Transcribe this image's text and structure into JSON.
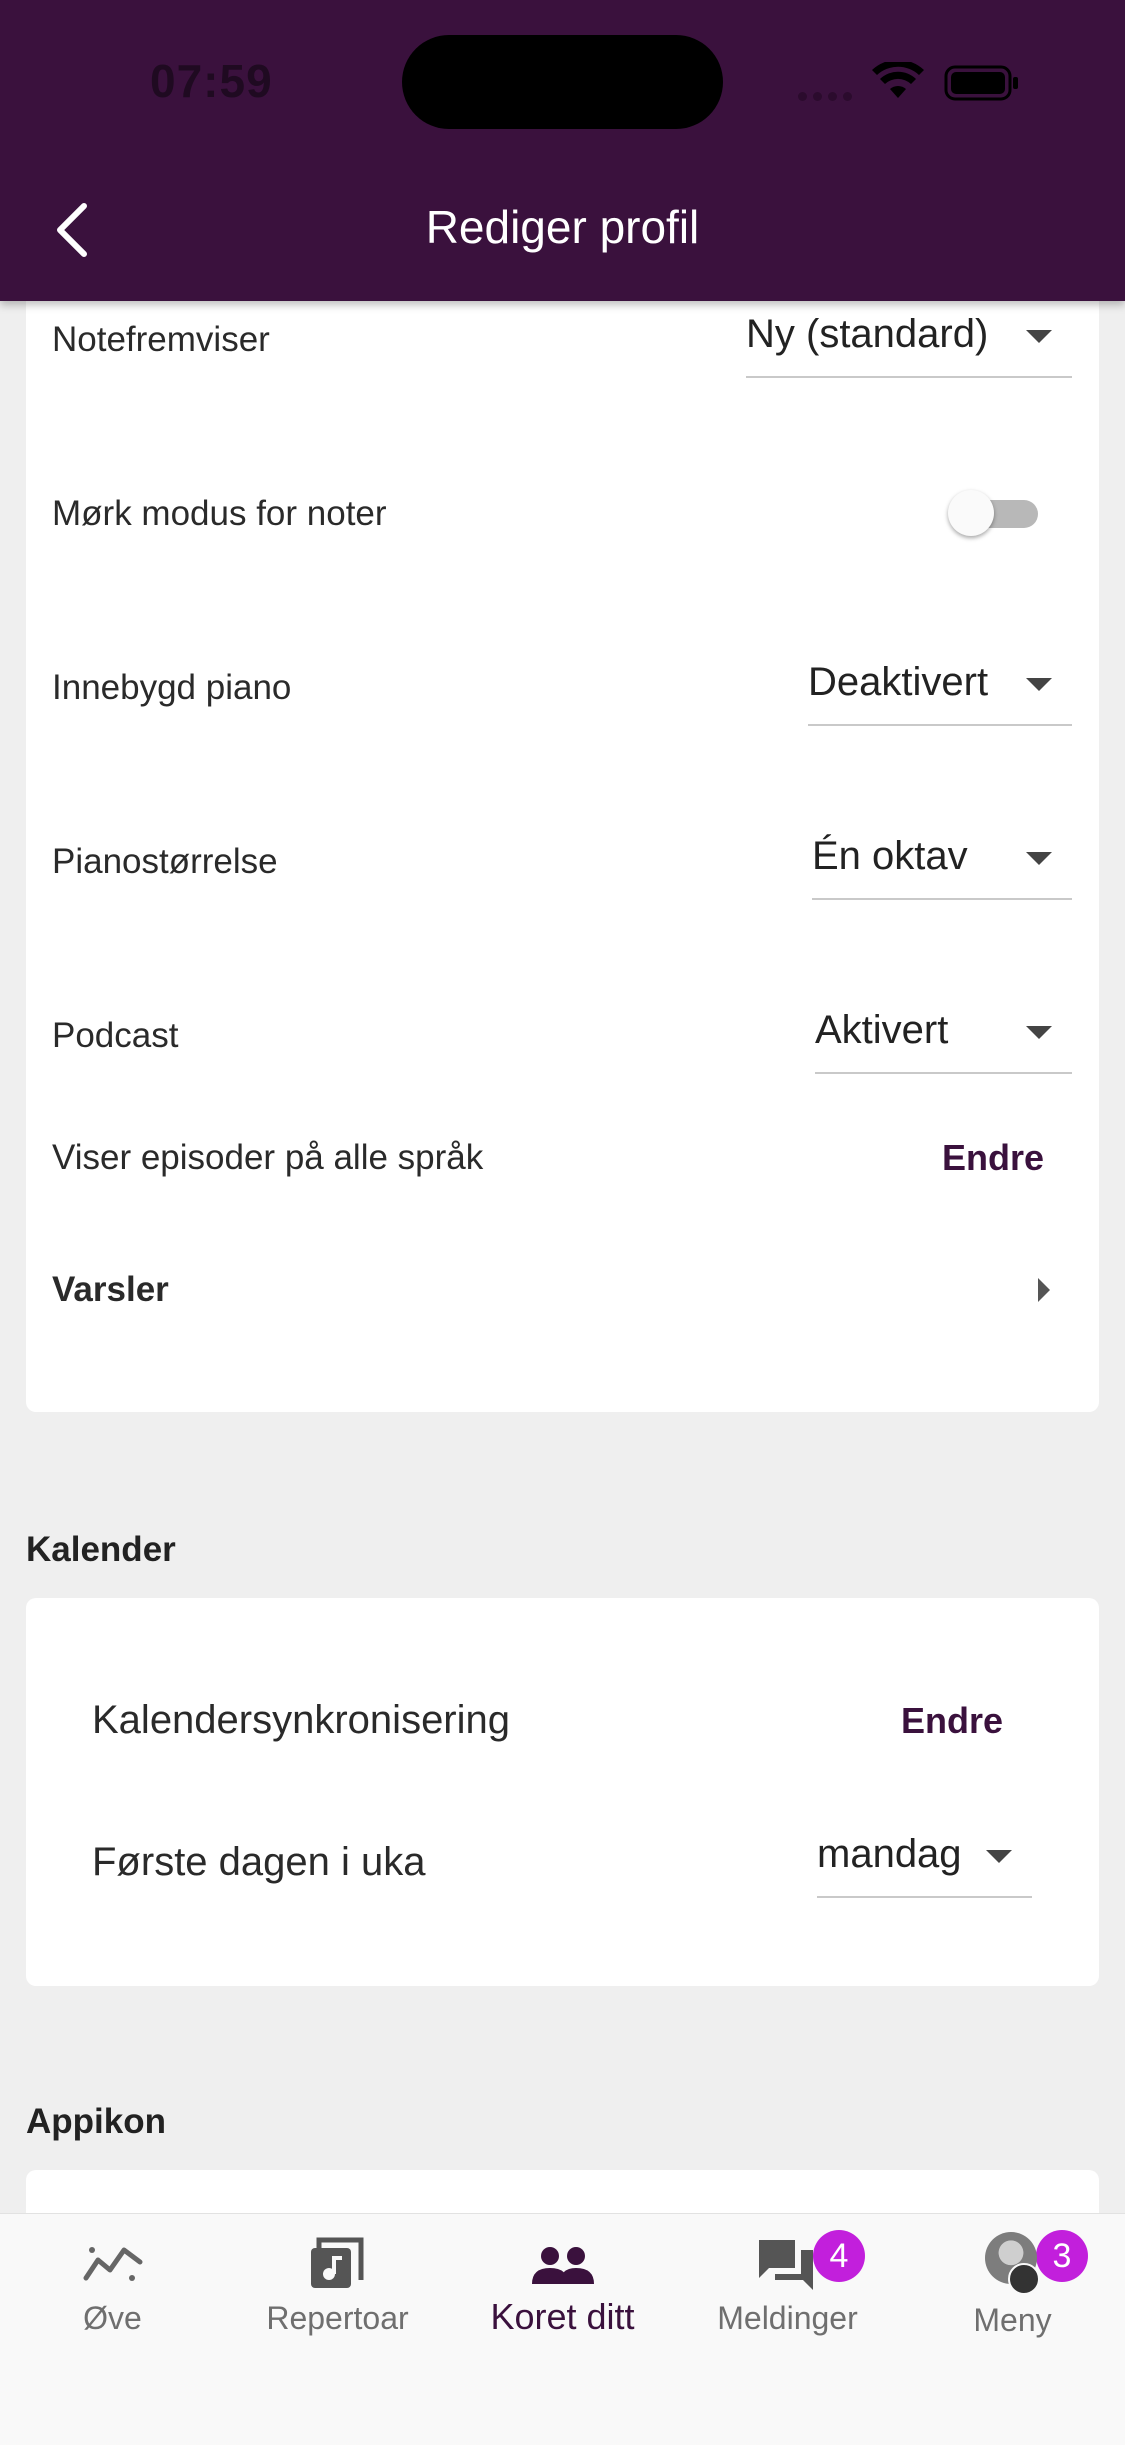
{
  "status_bar": {
    "time": "07:59"
  },
  "header": {
    "title": "Rediger profil"
  },
  "settings": {
    "note_viewer": {
      "label": "Notefremviser",
      "value": "Ny (standard)"
    },
    "dark_mode": {
      "label": "Mørk modus for noter",
      "on": false
    },
    "built_in_piano": {
      "label": "Innebygd piano",
      "value": "Deaktivert"
    },
    "piano_size": {
      "label": "Pianostørrelse",
      "value": "Én oktav"
    },
    "podcast": {
      "label": "Podcast",
      "value": "Aktivert"
    },
    "episodes": {
      "label": "Viser episoder på alle språk",
      "action": "Endre"
    },
    "notifications": {
      "label": "Varsler"
    }
  },
  "calendar": {
    "section_title": "Kalender",
    "sync": {
      "label": "Kalendersynkronisering",
      "action": "Endre"
    },
    "first_day": {
      "label": "Første dagen i uka",
      "value": "mandag"
    }
  },
  "app_icon": {
    "section_title": "Appikon"
  },
  "bottom_nav": {
    "items": [
      {
        "label": "Øve",
        "icon": "practice-chart-icon"
      },
      {
        "label": "Repertoar",
        "icon": "music-note-icon"
      },
      {
        "label": "Koret ditt",
        "icon": "group-icon",
        "active": true
      },
      {
        "label": "Meldinger",
        "icon": "chat-icon",
        "badge": "4"
      },
      {
        "label": "Meny",
        "icon": "avatar",
        "badge": "3"
      }
    ]
  },
  "colors": {
    "primary": "#3a113d",
    "badge": "#c21fdc",
    "background": "#efefef"
  }
}
